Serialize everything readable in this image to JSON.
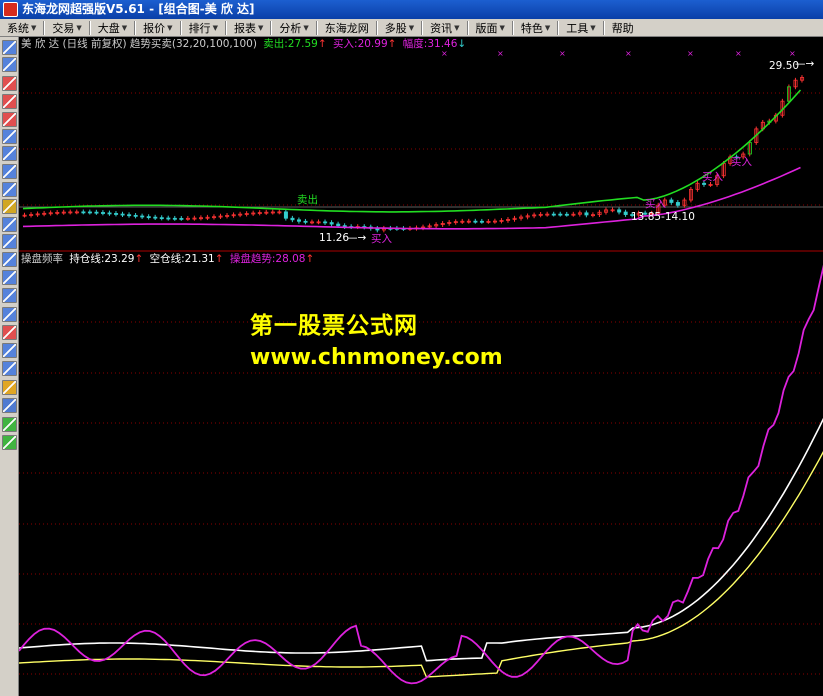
{
  "window": {
    "title": "东海龙网超强版V5.61 - [组合图-美 欣 达]"
  },
  "menu": [
    {
      "label": "系统",
      "arrow": true
    },
    {
      "label": "交易",
      "arrow": true
    },
    {
      "label": "大盘",
      "arrow": true
    },
    {
      "label": "报价",
      "arrow": true
    },
    {
      "label": "排行",
      "arrow": true
    },
    {
      "label": "报表",
      "arrow": true
    },
    {
      "label": "分析",
      "arrow": true
    },
    {
      "label": "东海龙网",
      "arrow": false
    },
    {
      "label": "多股",
      "arrow": true
    },
    {
      "label": "资讯",
      "arrow": true
    },
    {
      "label": "版面",
      "arrow": true
    },
    {
      "label": "特色",
      "arrow": true
    },
    {
      "label": "工具",
      "arrow": true
    },
    {
      "label": "帮助",
      "arrow": false
    }
  ],
  "toolbar_icons": [
    "grid-icon",
    "table-icon",
    "line-chart-icon",
    "bar-chart-icon",
    "candle-icon",
    "list-icon",
    "report-icon",
    "report2-icon",
    "chart3-icon",
    "people-icon",
    "fx-icon",
    "table2-icon",
    "f10-icon",
    "mini-icon",
    "rsi-icon",
    "tool1-icon",
    "dollar-icon",
    "tool2-icon",
    "tool3-icon",
    "pencil-icon",
    "move-icon",
    "arrow-up-icon",
    "arrow-down-icon"
  ],
  "main_panel": {
    "stock_name": "美 欣 达",
    "indicator_desc": "(日线 前复权) 趋势买卖(32,20,100,100)",
    "sell_label": "卖出:27.59",
    "buy_label": "买入:20.99",
    "range_label": "幅度:31.46",
    "up_arrow": "↑",
    "down_arrow": "↓",
    "annot_sell": "卖出",
    "annot_buy1": "买入",
    "annot_low": "11.26",
    "annot_range": "13.85-14.10",
    "annot_high": "29.50",
    "annot_buy2": "买入",
    "annot_buy3": "买入",
    "annot_buy4": "买入"
  },
  "sub_panel": {
    "title": "操盘频率",
    "hold_label": "持仓线:23.29",
    "empty_label": "空仓线:21.31",
    "trend_label": "操盘趋势:28.08",
    "up_arrow": "↑"
  },
  "watermark": {
    "title": "第一股票公式网",
    "url": "www.chnmoney.com"
  },
  "colors": {
    "green_band": "#22dd22",
    "magenta_band": "#dd22dd",
    "up_candle": "#ff3333",
    "down_candle": "#33cccc",
    "watermark": "#ffff00",
    "grid": "#8b0000"
  },
  "chart_data": {
    "type": "line",
    "title": "趋势买卖",
    "series": [
      {
        "name": "卖出",
        "values": [
          27.59
        ]
      },
      {
        "name": "买入",
        "values": [
          20.99
        ]
      },
      {
        "name": "持仓线",
        "values": [
          23.29
        ]
      },
      {
        "name": "空仓线",
        "values": [
          21.31
        ]
      },
      {
        "name": "操盘趋势",
        "values": [
          28.08
        ]
      }
    ],
    "annotations": [
      "11.26",
      "13.85-14.10",
      "29.50"
    ]
  }
}
